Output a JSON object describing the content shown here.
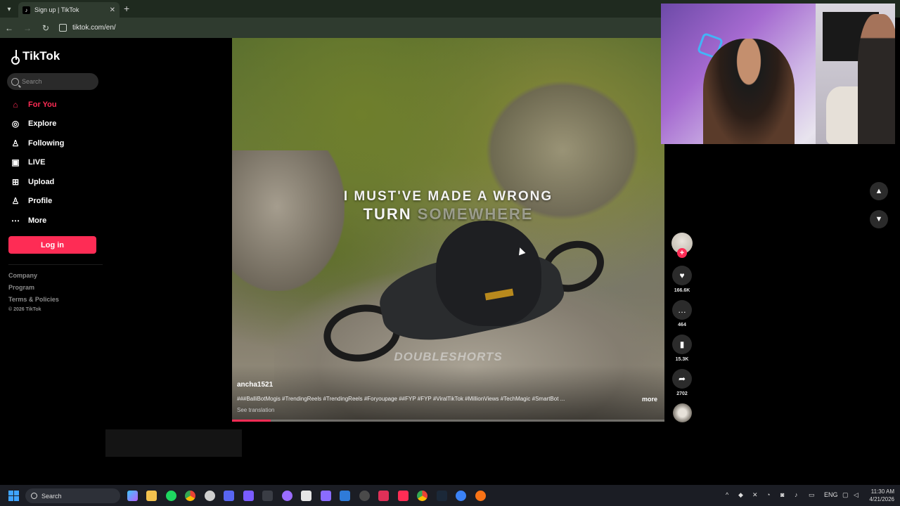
{
  "browser": {
    "tab_title": "Sign up | TikTok",
    "url": "tiktok.com/en/"
  },
  "sidebar": {
    "logo_text": "TikTok",
    "search_placeholder": "Search",
    "nav": [
      {
        "label": "For You",
        "icon": "home-icon",
        "active": true
      },
      {
        "label": "Explore",
        "icon": "compass-icon",
        "active": false
      },
      {
        "label": "Following",
        "icon": "following-icon",
        "active": false
      },
      {
        "label": "LIVE",
        "icon": "live-icon",
        "active": false
      },
      {
        "label": "Upload",
        "icon": "upload-icon",
        "active": false
      },
      {
        "label": "Profile",
        "icon": "profile-icon",
        "active": false
      },
      {
        "label": "More",
        "icon": "more-icon",
        "active": false
      }
    ],
    "login_label": "Log in",
    "footer_links": [
      "Company",
      "Program",
      "Terms & Policies"
    ],
    "copyright": "© 2026 TikTok"
  },
  "video": {
    "overlay_line1": "I MUST'VE MADE A WRONG",
    "overlay_line2_a": "TURN",
    "overlay_line2_b": "SOMEWHERE",
    "watermark": "DOUBLESHORTS",
    "author": "ancha1521",
    "caption": "###BalliBotMogis #TrendingReels #TrendingReels #Foryoupage ##FYP #FYP #ViralTikTok #MillionViews #TechMagic #SmartBot ...",
    "more_label": "more",
    "see_translation": "See translation",
    "progress": 0.09
  },
  "actions": {
    "likes": "166.6K",
    "comments": "464",
    "saves": "15.3K",
    "shares": "2702"
  },
  "taskbar": {
    "search_label": "Search",
    "language": "ENG",
    "time": "11:30 AM",
    "date": "4/21/2026"
  },
  "colors": {
    "accent": "#fe2c55",
    "background": "#000000",
    "taskbar": "#1b1d24"
  }
}
